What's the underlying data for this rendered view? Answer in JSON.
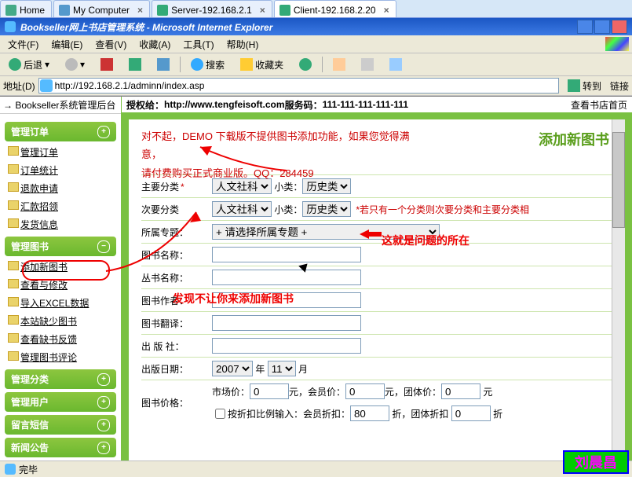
{
  "tabs": [
    {
      "label": "Home",
      "icon": "#4a8"
    },
    {
      "label": "My Computer",
      "icon": "#59c"
    },
    {
      "label": "Server-192.168.2.1",
      "icon": "#3a7"
    },
    {
      "label": "Client-192.168.2.20",
      "icon": "#3a7",
      "active": true
    }
  ],
  "ie": {
    "title": "Bookseller网上书店管理系统 - Microsoft Internet Explorer",
    "menu": [
      "文件(F)",
      "编辑(E)",
      "查看(V)",
      "收藏(A)",
      "工具(T)",
      "帮助(H)"
    ],
    "back": "后退",
    "search": "搜索",
    "fav": "收藏夹",
    "addr_label": "地址(D)",
    "url": "http://192.168.2.1/adminn/index.asp",
    "go": "转到",
    "links": "链接"
  },
  "header": {
    "sys": "Bookseller系统管理后台",
    "auth_label": "授权给：",
    "auth_site": "http://www.tengfeisoft.com",
    "svc_label": " 服务码：",
    "svc_code": "111-111-111-111-111",
    "home_link": "查看书店首页"
  },
  "sidebar": {
    "groups": [
      {
        "label": "管理订单",
        "items": [
          "管理订单",
          "订单统计",
          "退款申请",
          "汇款招领",
          "发货信息"
        ]
      },
      {
        "label": "管理图书",
        "items": [
          "添加新图书",
          "查看与修改",
          "导入EXCEL数据",
          "本站缺少图书",
          "查看缺书反馈",
          "管理图书评论"
        ]
      },
      {
        "label": "管理分类",
        "items": []
      },
      {
        "label": "管理用户",
        "items": []
      },
      {
        "label": "留言短信",
        "items": []
      },
      {
        "label": "新闻公告",
        "items": []
      }
    ]
  },
  "form": {
    "title": "添加新图书",
    "warn1": "对不起，DEMO 下载版不提供图书添加功能，如果您觉得满意，",
    "warn2": "请付费购买正式商业版。QQ：284459",
    "primary_cat": "主要分类",
    "secondary_cat": "次要分类",
    "sub": "小类：",
    "cat_opt": "人文社科",
    "sub_opt": "历史类",
    "note": "*若只有一个分类则次要分类和主要分类相",
    "topic": "所属专题：",
    "topic_opt": "+ 请选择所属专题 +",
    "book_name": "图书名称：",
    "series_name": "丛书名称：",
    "author": "图书作者：",
    "translator": "图书翻译：",
    "publisher": "出 版 社：",
    "pub_date": "出版日期：",
    "year": "2007",
    "year_u": "年",
    "month": "11",
    "month_u": "月",
    "price": "图书价格：",
    "market": "市场价：",
    "member": "元，会员价：",
    "group": "元，团体价：",
    "unit": "元",
    "zero": "0",
    "discount_chk": "按折扣比例输入：会员折扣：",
    "discount_member": "80",
    "discount_unit": "折，团体折扣",
    "discount_group": "0",
    "discount_unit2": "折"
  },
  "annotations": {
    "problem": "这就是问题的所在",
    "found": "发现不让你来添加新图书"
  },
  "status": "完毕",
  "signature": "刘晨昌"
}
